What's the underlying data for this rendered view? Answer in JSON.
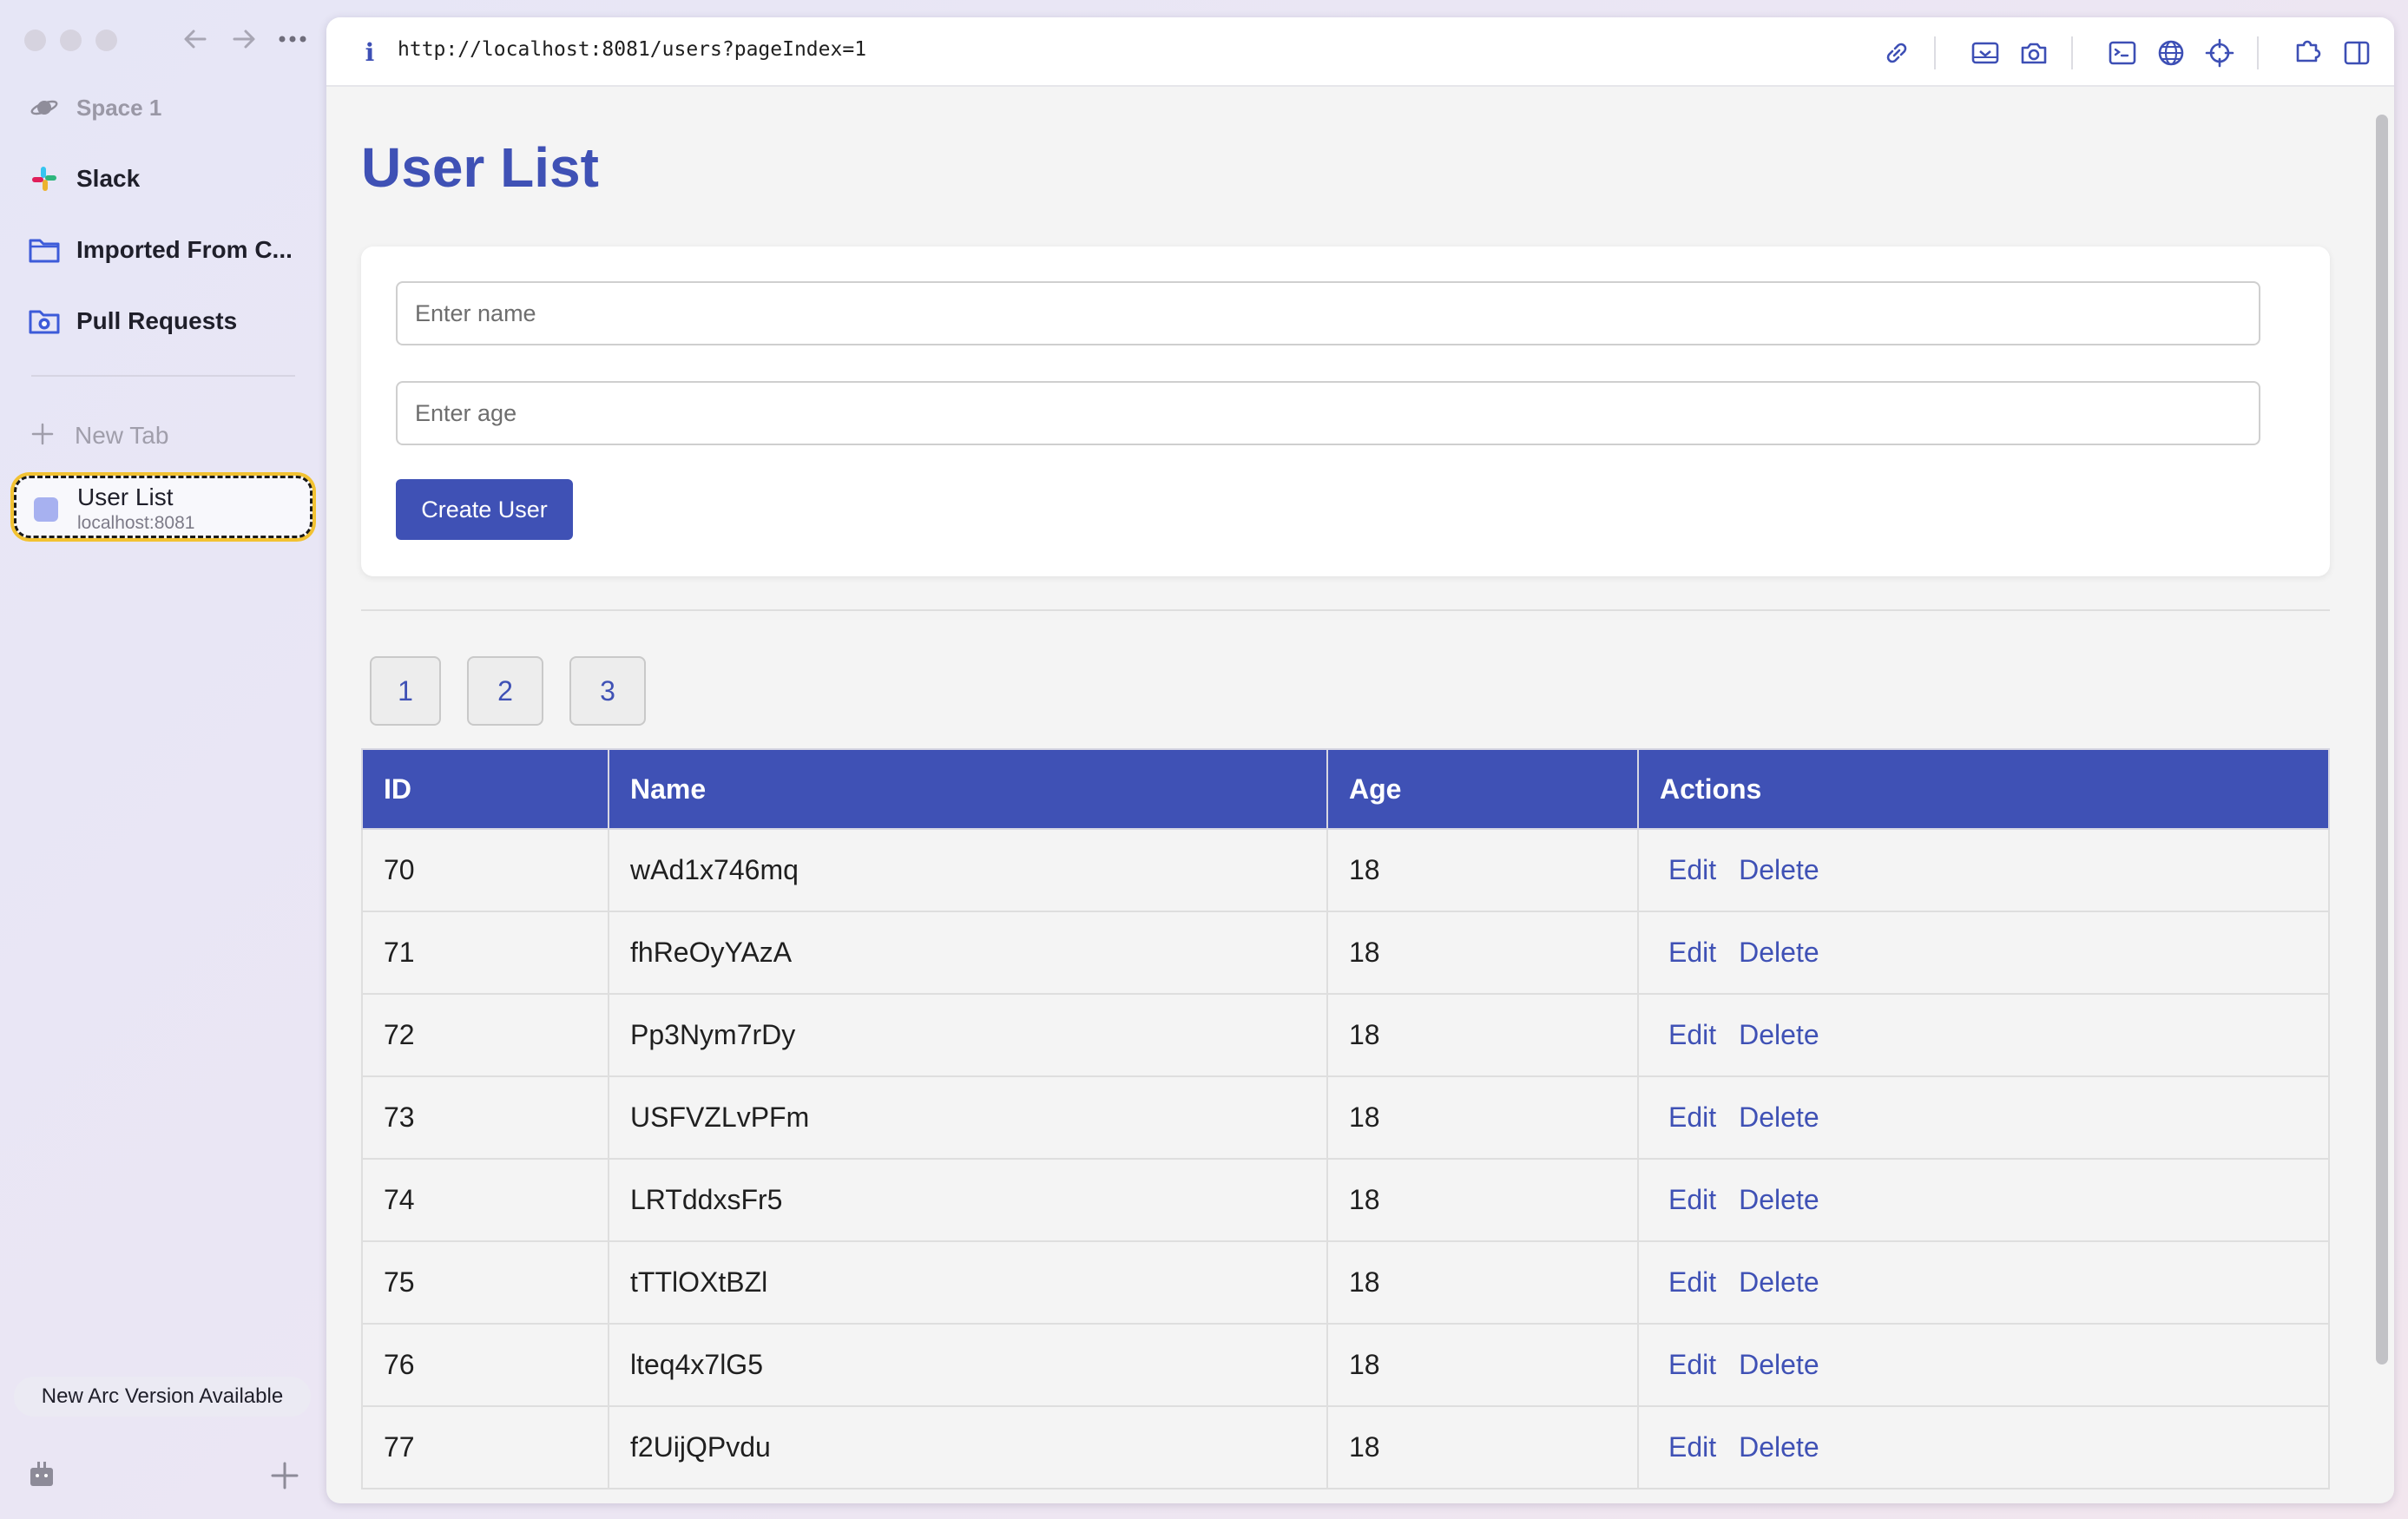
{
  "sidebar": {
    "space": "Space 1",
    "items": [
      {
        "label": "Slack"
      },
      {
        "label": "Imported From C..."
      },
      {
        "label": "Pull Requests"
      }
    ],
    "new_tab": "New Tab",
    "active_tab": {
      "title": "User List",
      "host": "localhost:8081"
    },
    "update_notice": "New Arc Version Available"
  },
  "browser": {
    "url": "http://localhost:8081/users?pageIndex=1",
    "info_glyph": "i"
  },
  "page": {
    "title": "User List",
    "form": {
      "name_placeholder": "Enter name",
      "age_placeholder": "Enter age",
      "create_button": "Create User"
    },
    "pagination": [
      "1",
      "2",
      "3"
    ],
    "table": {
      "headers": {
        "id": "ID",
        "name": "Name",
        "age": "Age",
        "actions": "Actions"
      },
      "edit_label": "Edit",
      "delete_label": "Delete",
      "rows": [
        {
          "id": "70",
          "name": "wAd1x746mq",
          "age": "18"
        },
        {
          "id": "71",
          "name": "fhReOyYAzA",
          "age": "18"
        },
        {
          "id": "72",
          "name": "Pp3Nym7rDy",
          "age": "18"
        },
        {
          "id": "73",
          "name": "USFVZLvPFm",
          "age": "18"
        },
        {
          "id": "74",
          "name": "LRTddxsFr5",
          "age": "18"
        },
        {
          "id": "75",
          "name": "tTTlOXtBZl",
          "age": "18"
        },
        {
          "id": "76",
          "name": "lteq4x7lG5",
          "age": "18"
        },
        {
          "id": "77",
          "name": "f2UijQPvdu",
          "age": "18"
        }
      ]
    }
  },
  "colors": {
    "accent": "#3f51b5",
    "active_tab_outline": "#f2c232"
  }
}
